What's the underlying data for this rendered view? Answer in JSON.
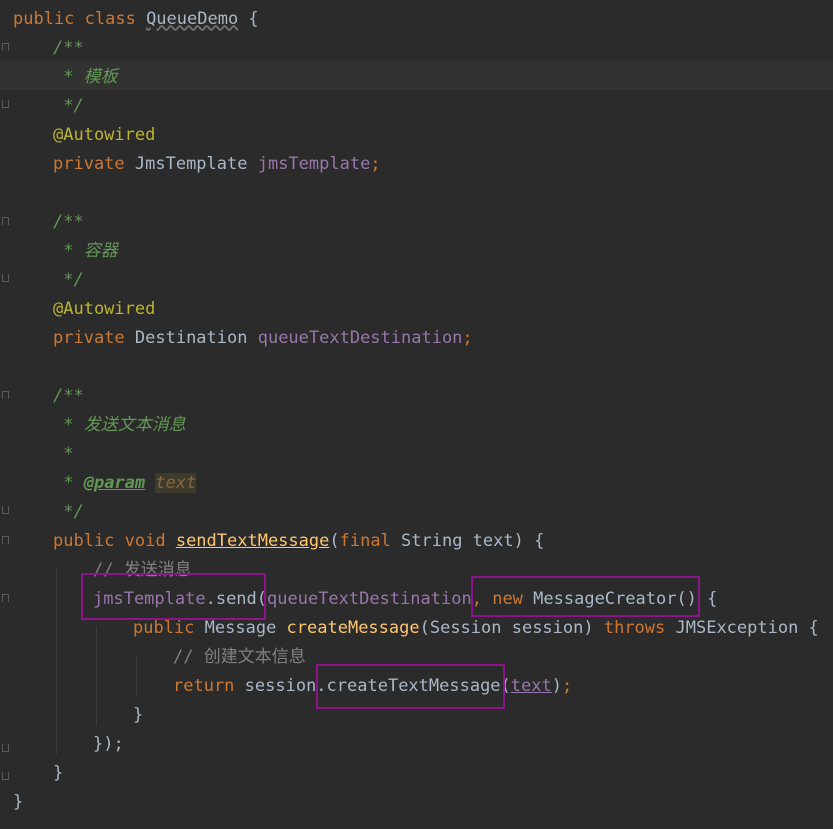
{
  "code": {
    "l1": {
      "kw": "public class ",
      "name": "QueueDemo",
      "rest": " {"
    },
    "l2": {
      "c": "/**"
    },
    "l3": {
      "c": " * 模板"
    },
    "l4": {
      "c": " */"
    },
    "l5": {
      "a": "@Autowired"
    },
    "l6": {
      "kw": "private ",
      "type": "JmsTemplate ",
      "field": "jmsTemplate",
      "semi": ";"
    },
    "l8": {
      "c": "/**"
    },
    "l9": {
      "c": " * 容器"
    },
    "l10": {
      "c": " */"
    },
    "l11": {
      "a": "@Autowired"
    },
    "l12": {
      "kw": "private ",
      "type": "Destination ",
      "field": "queueTextDestination",
      "semi": ";"
    },
    "l14": {
      "c": "/**"
    },
    "l15": {
      "c": " * 发送文本消息"
    },
    "l16": {
      "c": " *"
    },
    "l17": {
      "pre": " * ",
      "tag": "@param",
      "sp": " ",
      "val": "text"
    },
    "l18": {
      "c": " */"
    },
    "l19": {
      "kw": "public void ",
      "method": "sendTextMessage",
      "p1": "(",
      "kw2": "final ",
      "rest": "String text) {"
    },
    "l20": {
      "c": "// 发送消息"
    },
    "l21": {
      "field": "jmsTemplate",
      "call": ".send(",
      "field2": "queueTextDestination",
      "comma": ", ",
      "kw": "new ",
      "rest": "MessageCreator() {"
    },
    "l22": {
      "kw": "public ",
      "type": "Message ",
      "method": "createMessage",
      "mid": "(Session session) ",
      "kw2": "throws ",
      "rest": "JMSException {"
    },
    "l23": {
      "c": "// 创建文本信息"
    },
    "l24": {
      "kw": "return ",
      "obj": "session.",
      "call": "createTextMessage(",
      "arg": "text",
      "end": ")",
      "semi": ";"
    },
    "l25": {
      "t": "}"
    },
    "l26": {
      "t": "});"
    },
    "l27": {
      "t": "}"
    },
    "l28": {
      "t": "}"
    }
  },
  "highlight_color": "#8b148b"
}
